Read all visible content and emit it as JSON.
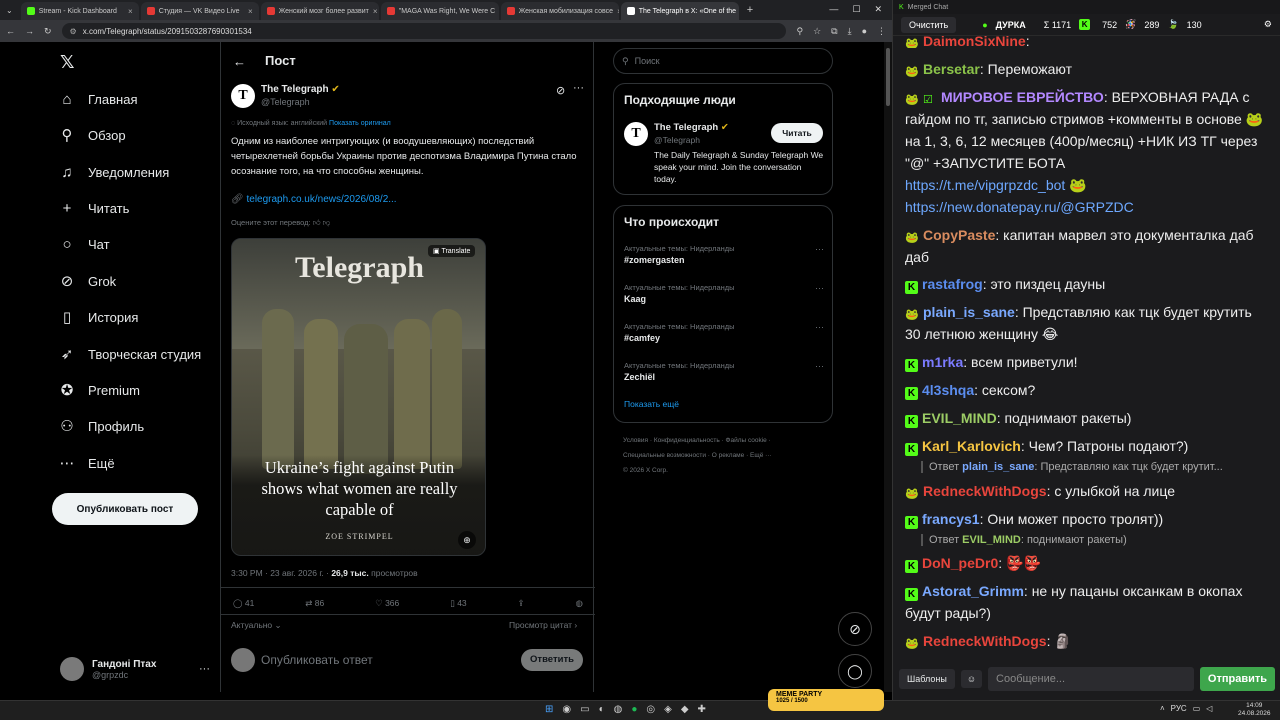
{
  "browser": {
    "tabs": [
      {
        "title": "Stream - Kick Dashboard",
        "color": "#53fc18"
      },
      {
        "title": "Студия — VK Видео Live",
        "color": "#e53935"
      },
      {
        "title": "Женский мозг более развит",
        "color": "#e53935"
      },
      {
        "title": "\"MAGA Was Right, We Were C",
        "color": "#e53935"
      },
      {
        "title": "Женская мобилизация совсе",
        "color": "#e53935"
      },
      {
        "title": "The Telegraph в X: «One of the",
        "color": "#ffffff"
      }
    ],
    "url": "x.com/Telegraph/status/2091503287690301534"
  },
  "x": {
    "nav": [
      {
        "label": "Главная",
        "icon": "home-icon",
        "glyph": "⌂"
      },
      {
        "label": "Обзор",
        "icon": "search-icon",
        "glyph": "⚲"
      },
      {
        "label": "Уведомления",
        "icon": "bell-icon",
        "glyph": "🔔︎"
      },
      {
        "label": "Читать",
        "icon": "follow-icon",
        "glyph": "👤︎"
      },
      {
        "label": "Чат",
        "icon": "chat-icon",
        "glyph": "◯"
      },
      {
        "label": "Grok",
        "icon": "grok-icon",
        "glyph": "⊘"
      },
      {
        "label": "История",
        "icon": "bookmark-icon",
        "glyph": "▯"
      },
      {
        "label": "Творческая студия",
        "icon": "rocket-icon",
        "glyph": "➶"
      },
      {
        "label": "Premium",
        "icon": "premium-icon",
        "glyph": "✪"
      },
      {
        "label": "Профиль",
        "icon": "profile-icon",
        "glyph": "⚇"
      },
      {
        "label": "Ещё",
        "icon": "more-icon",
        "glyph": "⋯"
      }
    ],
    "post_button": "Опубликовать пост",
    "profile": {
      "name": "Гандоні Птах",
      "handle": "@grpzdc"
    },
    "header_title": "Пост",
    "tweet": {
      "author": "The Telegraph",
      "handle": "@Telegraph",
      "source_lang": "Исходный язык: английский",
      "show_original": "Показать оригинал",
      "text": "Одним из наиболее интригующих (и воодушевляющих) последствий четырехлетней борьбы Украины против деспотизма Владимира Путина стало осознание того, на что способны женщины.",
      "link": "telegraph.co.uk/news/2026/08/2...",
      "rate": "Оцените этот перевод:",
      "image_masthead": "Telegraph",
      "image_headline": "Ukraine’s fight against Putin shows what women are really capable of",
      "image_byline": "ZOE STRIMPEL",
      "image_translate": "Translate",
      "time": "3:30 PM · 23 авг. 2026 г. ·",
      "views": "26,9 тыс.",
      "views_label": "просмотров",
      "replies": "41",
      "retweets": "86",
      "likes": "366",
      "bookmarks": "43",
      "sort": "Актуально",
      "quotes": "Просмотр цитат",
      "reply_placeholder": "Опубликовать ответ",
      "reply_button": "Ответить"
    },
    "search_placeholder": "Поиск",
    "suggest": {
      "title": "Подходящие люди",
      "name": "The Telegraph",
      "handle": "@Telegraph",
      "follow": "Читать",
      "bio": "The Daily Telegraph & Sunday Telegraph We speak your mind. Join the conversation today."
    },
    "trends": {
      "title": "Что происходит",
      "items": [
        {
          "context": "Актуальные темы: Нидерланды",
          "name": "#zomergasten"
        },
        {
          "context": "Актуальные темы: Нидерланды",
          "name": "Kaag"
        },
        {
          "context": "Актуальные темы: Нидерланды",
          "name": "#camfey"
        },
        {
          "context": "Актуальные темы: Нидерланды",
          "name": "Zechiël"
        }
      ],
      "more": "Показать ещё"
    },
    "footer": [
      "Условия",
      "Конфиденциальность",
      "Файлы cookie",
      "Специальные возможности",
      "О рекламе",
      "Ещё ···",
      "© 2026 X Corp."
    ]
  },
  "chat": {
    "window_title": "Merged Chat",
    "clear": "Очистить",
    "live_label": "ДУРКА",
    "stats": {
      "total": "Σ 1171",
      "kick": "752",
      "vk": "289",
      "other": "130"
    },
    "messages": [
      {
        "user": "DaimonSixNine",
        "color": "#e8453c",
        "text": ":",
        "badge": "w"
      },
      {
        "user": "Bersetar",
        "color": "#8bc34a",
        "text": ": Переможают",
        "badge": "w"
      },
      {
        "user": "МИРОВОЕ ЕВРЕЙСТВО",
        "color": "#b388ff",
        "text": ": ВЕРХОВНАЯ РАДА с гайдом по тг, записью стримов +комменты в основе 🐸 на 1, 3, 6, 12 месяцев (400р/месяц) +НИК ИЗ ТГ через \"@\" +ЗАПУСТИТЕ БОТА",
        "badge": "w"
      },
      {
        "user": "",
        "color": "#6ea8fe",
        "text": "https://t.me/vipgrpzdc_bot",
        "badge": ""
      },
      {
        "user": "",
        "color": "#6ea8fe",
        "text": "https://new.donatepay.ru/@GRPZDC",
        "badge": ""
      },
      {
        "user": "CopyPaste",
        "color": "#d98c5f",
        "text": ": капитан марвел это документалка даб даб",
        "badge": "w"
      },
      {
        "user": "rastafrog",
        "color": "#5b8def",
        "text": ": это пиздец дауны",
        "badge": "k"
      },
      {
        "user": "plain_is_sane",
        "color": "#7aa9ff",
        "text": ": Представляю как тцк будет крутить 30 летнюю женщину 😂",
        "badge": "w"
      },
      {
        "user": "m1rka",
        "color": "#7b7bff",
        "text": ": всем приветули!",
        "badge": "k"
      },
      {
        "user": "4l3shqa",
        "color": "#5b8def",
        "text": ": сексом?",
        "badge": "k"
      },
      {
        "user": "EVIL_MIND",
        "color": "#9ccc65",
        "text": ": поднимают ракеты)",
        "badge": "k"
      },
      {
        "user": "Karl_Karlovich",
        "color": "#f5c542",
        "text": ": Чем? Патроны подают?)",
        "badge": "k"
      },
      {
        "user": "RedneckWithDogs",
        "color": "#e8453c",
        "text": ": с улыбкой на лице",
        "badge": "w"
      },
      {
        "user": "francys1",
        "color": "#7aa9ff",
        "text": ": Они может просто тролят))",
        "badge": "k"
      },
      {
        "user": "DoN_peDr0",
        "color": "#e8453c",
        "text": ": 👺👺",
        "badge": "k"
      },
      {
        "user": "Astorat_Grimm",
        "color": "#7aa9ff",
        "text": ": не ну пацаны оксанкам в окопах будут рады?)",
        "badge": "k"
      },
      {
        "user": "RedneckWithDogs",
        "color": "#e8453c",
        "text": ": 🗿",
        "badge": "w"
      }
    ],
    "reply1": {
      "prefix": "Ответ",
      "user": "plain_is_sane",
      "text": ": Представляю как тцк будет крутит..."
    },
    "reply2": {
      "prefix": "Ответ",
      "user": "EVIL_MIND",
      "text": ": поднимают ракеты)"
    },
    "templates": "Шаблоны",
    "input_placeholder": "Сообщение...",
    "send": "Отправить"
  },
  "taskbar": {
    "lang": "РУС",
    "time": "14:09",
    "date": "24.08.2026",
    "overlay": "MEME PARTY",
    "overlay_count": "1025 / 1500"
  }
}
